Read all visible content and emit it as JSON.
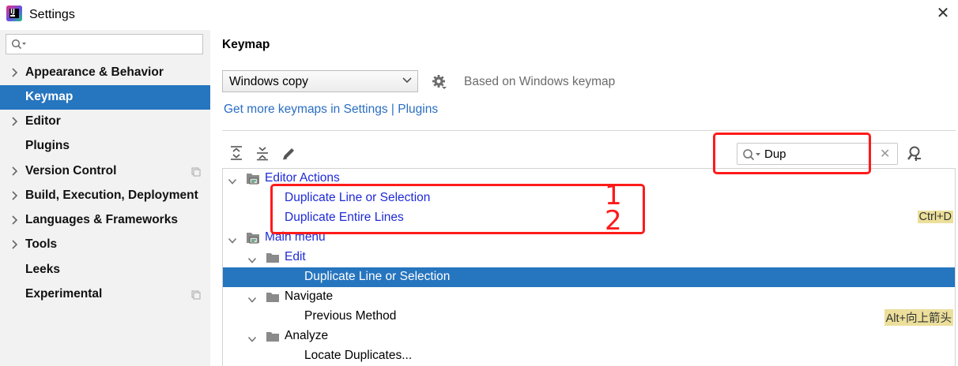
{
  "window": {
    "title": "Settings"
  },
  "sidebar": {
    "search_placeholder": "",
    "items": [
      {
        "label": "Appearance & Behavior",
        "expandable": true,
        "selected": false,
        "project_icon": false
      },
      {
        "label": "Keymap",
        "expandable": false,
        "selected": true,
        "project_icon": false
      },
      {
        "label": "Editor",
        "expandable": true,
        "selected": false,
        "project_icon": false
      },
      {
        "label": "Plugins",
        "expandable": false,
        "selected": false,
        "project_icon": false
      },
      {
        "label": "Version Control",
        "expandable": true,
        "selected": false,
        "project_icon": true
      },
      {
        "label": "Build, Execution, Deployment",
        "expandable": true,
        "selected": false,
        "project_icon": false
      },
      {
        "label": "Languages & Frameworks",
        "expandable": true,
        "selected": false,
        "project_icon": false
      },
      {
        "label": "Tools",
        "expandable": true,
        "selected": false,
        "project_icon": false
      },
      {
        "label": "Leeks",
        "expandable": false,
        "selected": false,
        "project_icon": false
      },
      {
        "label": "Experimental",
        "expandable": false,
        "selected": false,
        "project_icon": true
      }
    ]
  },
  "main": {
    "heading": "Keymap",
    "keymap_select": {
      "value": "Windows copy"
    },
    "based_on": "Based on Windows keymap",
    "more_link": "Get more keymaps in Settings | Plugins",
    "search": {
      "value": "Dup"
    },
    "tree": [
      {
        "label": "Editor Actions",
        "kind": "group",
        "expanded": true,
        "blue": true,
        "shortcut": ""
      },
      {
        "label": "Duplicate Line or Selection",
        "kind": "action",
        "blue": true,
        "shortcut": ""
      },
      {
        "label": "Duplicate Entire Lines",
        "kind": "action",
        "blue": true,
        "shortcut": "Ctrl+D"
      },
      {
        "label": "Main menu",
        "kind": "group",
        "expanded": true,
        "blue": true,
        "shortcut": ""
      },
      {
        "label": "Edit",
        "kind": "folder",
        "expanded": true,
        "blue": true,
        "shortcut": ""
      },
      {
        "label": "Duplicate Line or Selection",
        "kind": "action",
        "selected": true,
        "shortcut": ""
      },
      {
        "label": "Navigate",
        "kind": "folder",
        "expanded": true,
        "shortcut": ""
      },
      {
        "label": "Previous Method",
        "kind": "action",
        "shortcut": "Alt+向上箭头"
      },
      {
        "label": "Analyze",
        "kind": "folder",
        "expanded": true,
        "shortcut": ""
      },
      {
        "label": "Locate Duplicates...",
        "kind": "action",
        "shortcut": ""
      }
    ]
  },
  "annotations": {
    "numbers": [
      "1",
      "2"
    ],
    "color": "#ff1a1a"
  },
  "colors": {
    "selection": "#2675bf",
    "link": "#2a6ec2",
    "action_text": "#1e2ad6",
    "shortcut_bg": "#ecdf9b"
  }
}
